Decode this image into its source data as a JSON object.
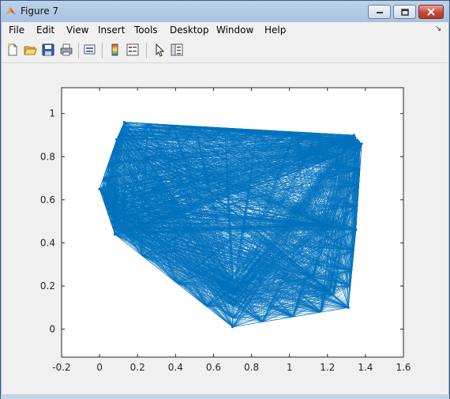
{
  "window": {
    "title": "Figure 7"
  },
  "menu": [
    "File",
    "Edit",
    "View",
    "Insert",
    "Tools",
    "Desktop",
    "Window",
    "Help"
  ],
  "toolbar": [
    {
      "icon": "new-figure-icon"
    },
    {
      "icon": "open-file-icon"
    },
    {
      "icon": "save-icon"
    },
    {
      "icon": "print-icon"
    },
    {
      "icon": "link-plot-icon"
    },
    {
      "icon": "colorbar-icon"
    },
    {
      "icon": "legend-icon"
    },
    {
      "icon": "edit-plot-arrow-icon"
    },
    {
      "icon": "property-inspector-icon"
    }
  ],
  "colors": {
    "line": "#0072bd",
    "axes_bg": "#ffffff",
    "figure_bg": "#f0f0f0"
  },
  "chart_data": {
    "type": "line",
    "title": "",
    "xlabel": "",
    "ylabel": "",
    "xlim": [
      -0.2,
      1.6
    ],
    "ylim": [
      -0.13,
      1.12
    ],
    "xticks": [
      -0.2,
      0,
      0.2,
      0.4,
      0.6,
      0.8,
      1,
      1.2,
      1.4,
      1.6
    ],
    "xtick_labels": [
      "-0.2",
      "0",
      "0.2",
      "0.4",
      "0.6",
      "0.8",
      "1",
      "1.2",
      "1.4",
      "1.6"
    ],
    "yticks": [
      0,
      0.2,
      0.4,
      0.6,
      0.8,
      1
    ],
    "ytick_labels": [
      "0",
      "0.2",
      "0.4",
      "0.6",
      "0.8",
      "1"
    ],
    "grid": false,
    "description_style": "complete graph of many points; all pairwise edges drawn",
    "hull_points": [
      {
        "x": 0.0,
        "y": 0.65
      },
      {
        "x": 0.04,
        "y": 0.56
      },
      {
        "x": 0.08,
        "y": 0.44
      },
      {
        "x": 0.7,
        "y": 0.01
      },
      {
        "x": 1.31,
        "y": 0.1
      },
      {
        "x": 1.35,
        "y": 0.46
      },
      {
        "x": 1.38,
        "y": 0.86
      },
      {
        "x": 1.34,
        "y": 0.9
      },
      {
        "x": 0.66,
        "y": 0.93
      },
      {
        "x": 0.13,
        "y": 0.96
      },
      {
        "x": 0.09,
        "y": 0.88
      }
    ]
  }
}
